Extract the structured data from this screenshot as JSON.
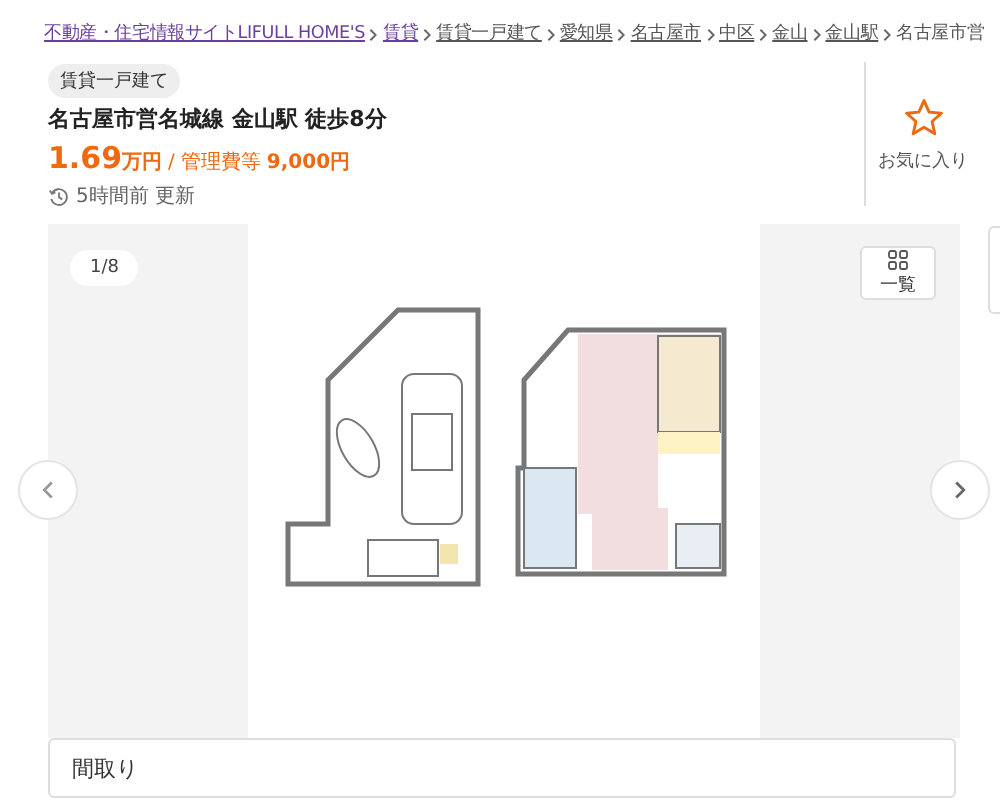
{
  "breadcrumb": [
    {
      "label": "不動産・住宅情報サイトLIFULL HOME'S",
      "visited": true
    },
    {
      "label": "賃貸",
      "visited": true
    },
    {
      "label": "賃貸一戸建て",
      "visited": false
    },
    {
      "label": "愛知県",
      "visited": false
    },
    {
      "label": "名古屋市",
      "visited": false
    },
    {
      "label": "中区",
      "visited": false
    },
    {
      "label": "金山",
      "visited": false
    },
    {
      "label": "金山駅",
      "visited": false
    },
    {
      "label": "名古屋市営",
      "visited": false,
      "current": true
    }
  ],
  "category_tag": "賃貸一戸建て",
  "title": "名古屋市営名城線 金山駅 徒歩8分",
  "price": {
    "amount": "1.69",
    "unit": "万円",
    "separator": "/",
    "fee_label": "管理費等",
    "fee": "9,000円"
  },
  "updated": "5時間前 更新",
  "favorite": {
    "label": "お気に入り",
    "selected": false
  },
  "gallery": {
    "counter": "1/8",
    "list_button": "一覧",
    "caption": "間取り"
  }
}
